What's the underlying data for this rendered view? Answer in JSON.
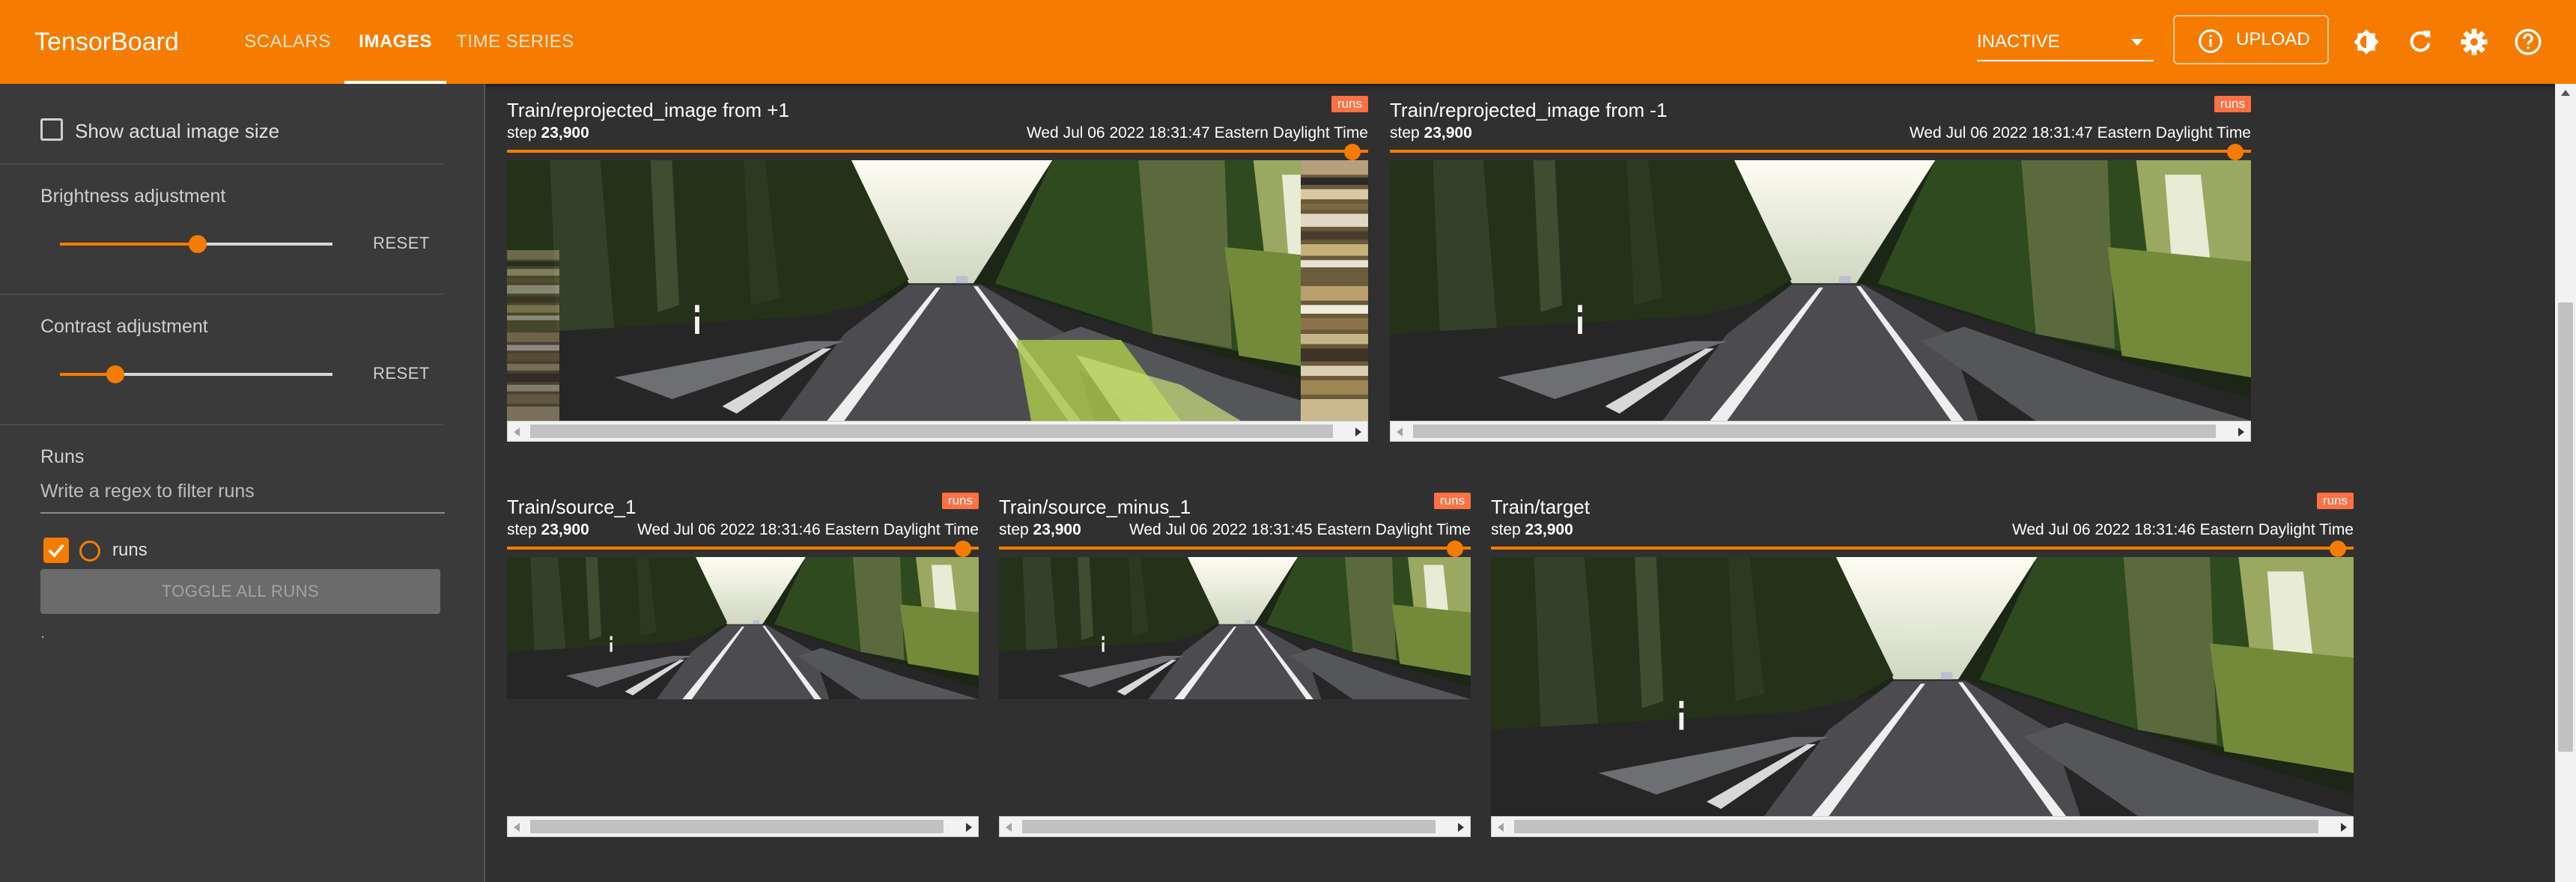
{
  "app": {
    "brand": "TensorBoard"
  },
  "nav": {
    "tabs": [
      {
        "label": "SCALARS"
      },
      {
        "label": "IMAGES"
      },
      {
        "label": "TIME SERIES"
      }
    ]
  },
  "header": {
    "run_state": "INACTIVE",
    "upload_label": "UPLOAD",
    "icons": [
      "brightness-icon",
      "refresh-icon",
      "settings-icon",
      "help-icon"
    ]
  },
  "sidebar": {
    "show_actual_size_label": "Show actual image size",
    "brightness": {
      "label": "Brightness adjustment",
      "reset": "RESET",
      "value": 0.5
    },
    "contrast": {
      "label": "Contrast adjustment",
      "reset": "RESET",
      "value": 0.2
    },
    "runs": {
      "title": "Runs",
      "filter_placeholder": "Write a regex to filter runs",
      "items": [
        {
          "name": "runs",
          "checked": true
        }
      ],
      "toggle_all": "TOGGLE ALL RUNS",
      "footer": "."
    }
  },
  "cards": [
    {
      "title": "Train/reprojected_image from +1",
      "run": "runs",
      "step_label": "step",
      "step": "23,900",
      "time": "Wed Jul 06 2022 18:31:47 Eastern Daylight Time"
    },
    {
      "title": "Train/reprojected_image from -1",
      "run": "runs",
      "step_label": "step",
      "step": "23,900",
      "time": "Wed Jul 06 2022 18:31:47 Eastern Daylight Time"
    },
    {
      "title": "Train/source_1",
      "run": "runs",
      "step_label": "step",
      "step": "23,900",
      "time": "Wed Jul 06 2022 18:31:46 Eastern Daylight Time"
    },
    {
      "title": "Train/source_minus_1",
      "run": "runs",
      "step_label": "step",
      "step": "23,900",
      "time": "Wed Jul 06 2022 18:31:45 Eastern Daylight Time"
    },
    {
      "title": "Train/target",
      "run": "runs",
      "step_label": "step",
      "step": "23,900",
      "time": "Wed Jul 06 2022 18:31:46 Eastern Daylight Time"
    }
  ],
  "colors": {
    "accent": "#f57c00",
    "badge": "#ff7043",
    "background": "#303030"
  }
}
